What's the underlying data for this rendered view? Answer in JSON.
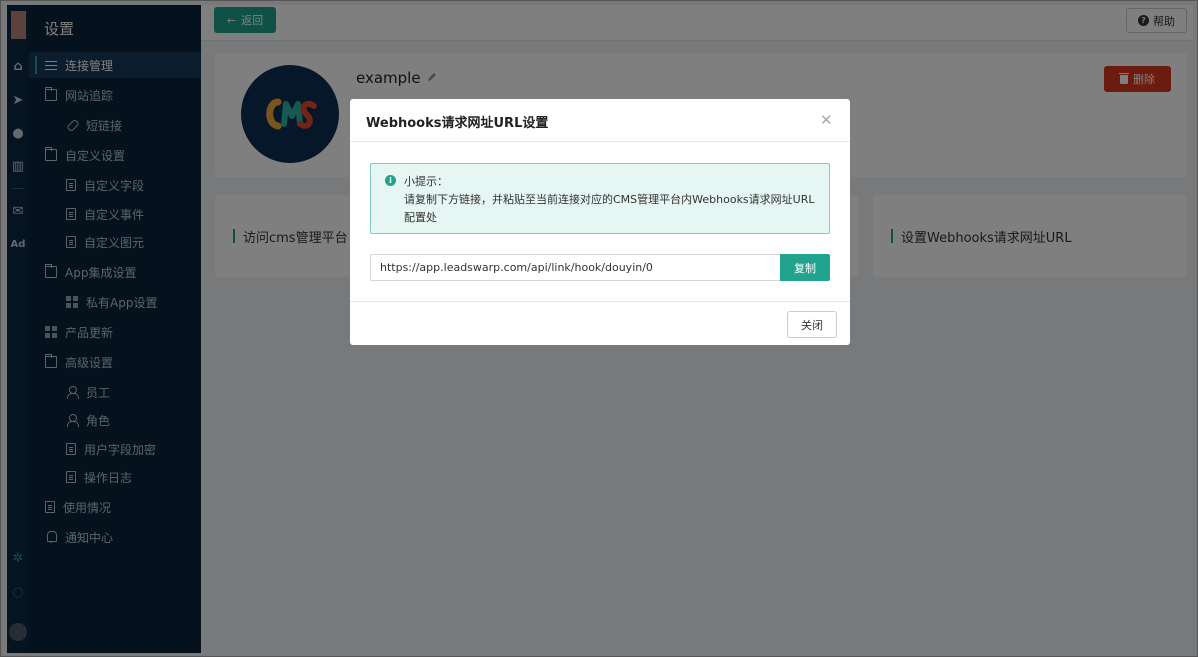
{
  "sidebar": {
    "title": "设置",
    "items": [
      {
        "label": "连接管理",
        "icon": "sliders-icon"
      },
      {
        "label": "网站追踪",
        "icon": "folder-icon"
      },
      {
        "label": "短链接",
        "icon": "link-icon"
      },
      {
        "label": "自定义设置",
        "icon": "folder-icon"
      },
      {
        "label": "自定义字段",
        "icon": "field-icon"
      },
      {
        "label": "自定义事件",
        "icon": "event-icon"
      },
      {
        "label": "自定义图元",
        "icon": "pixel-icon"
      },
      {
        "label": "App集成设置",
        "icon": "folder-icon"
      },
      {
        "label": "私有App设置",
        "icon": "grid-icon"
      },
      {
        "label": "产品更新",
        "icon": "grid-icon"
      },
      {
        "label": "高级设置",
        "icon": "folder-icon"
      },
      {
        "label": "员工",
        "icon": "user-icon"
      },
      {
        "label": "角色",
        "icon": "role-icon"
      },
      {
        "label": "用户字段加密",
        "icon": "encrypt-icon"
      },
      {
        "label": "操作日志",
        "icon": "log-icon"
      },
      {
        "label": "使用情况",
        "icon": "usage-icon"
      },
      {
        "label": "通知中心",
        "icon": "bell-icon"
      }
    ]
  },
  "rail": {
    "ad_label": "Ad"
  },
  "header": {
    "back_label": "返回",
    "help_label": "帮助"
  },
  "connection": {
    "name": "example",
    "delete_label": "删除",
    "logo_text": "CMS"
  },
  "cards": [
    {
      "title": "访问cms管理平台"
    },
    {
      "title": "设置Webhooks请求网址URL"
    }
  ],
  "modal": {
    "title": "Webhooks请求网址URL设置",
    "tip_title": "小提示：",
    "tip_body": "请复制下方链接，并粘贴至当前连接对应的CMS管理平台内Webhooks请求网址URL配置处",
    "url": "https://app.leadswarp.com/api/link/hook/douyin/0",
    "copy_label": "复制",
    "close_label": "关闭"
  },
  "colors": {
    "accent": "#21a38f",
    "danger": "#d9381e",
    "sidebar_bg": "#0b2239"
  }
}
